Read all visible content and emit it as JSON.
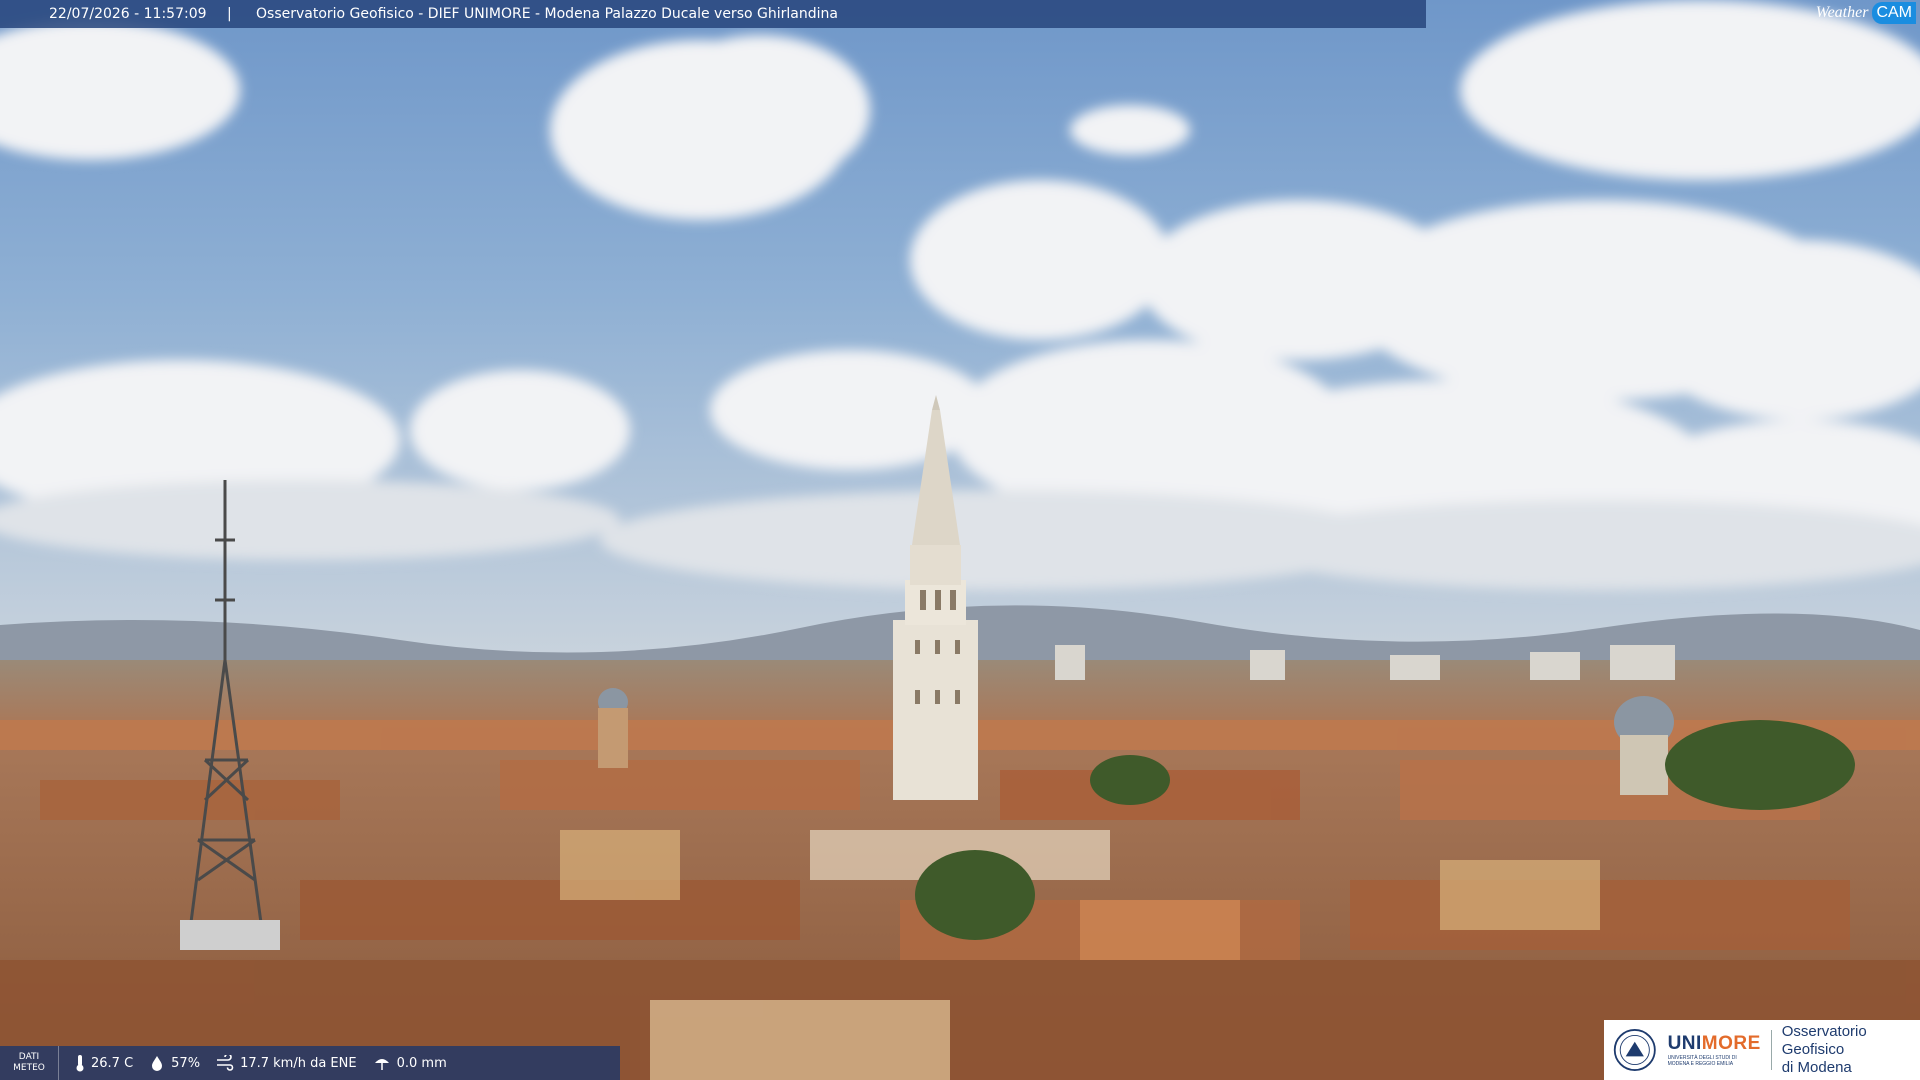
{
  "overlay": {
    "timestamp": "22/07/2026 - 11:57:09",
    "separator": "|",
    "title": "Osservatorio Geofisico - DIEF UNIMORE - Modena Palazzo Ducale verso Ghirlandina"
  },
  "brand": {
    "weather": "Weather",
    "cam": "CAM"
  },
  "weather": {
    "label_line1": "DATI",
    "label_line2": "METEO",
    "temperature": "26.7 C",
    "humidity": "57%",
    "wind": "17.7 km/h da ENE",
    "rain": "0.0 mm",
    "icons": [
      "thermometer-icon",
      "humidity-icon",
      "wind-icon",
      "rain-icon"
    ]
  },
  "logo": {
    "uni": "UNI",
    "more": "MORE",
    "uni_sub": "UNIVERSITÀ DEGLI STUDI DI MODENA E REGGIO EMILIA",
    "obs_line1": "Osservatorio Geofisico",
    "obs_line2": "di Modena"
  },
  "colors": {
    "sky_top": "#6f97c9",
    "sky_bottom": "#c9d3dd",
    "roof": "#b07a52",
    "tower": "#e8e2d6",
    "overlay": "#28467d",
    "unimore_orange": "#e36b2b"
  }
}
